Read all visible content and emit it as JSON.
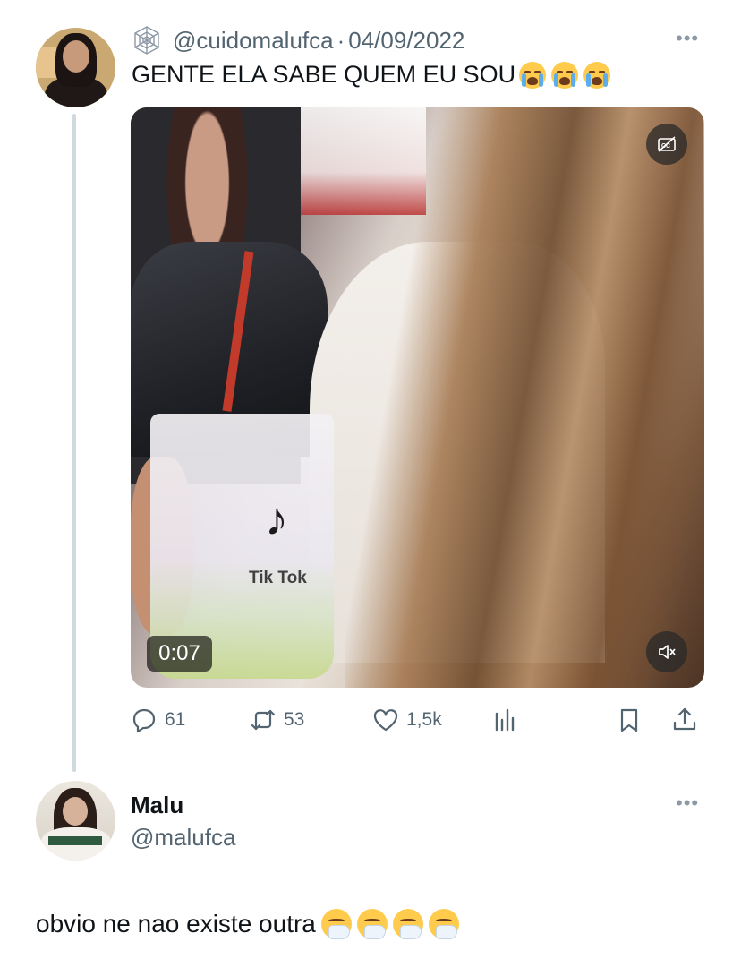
{
  "original_tweet": {
    "handle": "@cuidomalufca",
    "separator": "·",
    "date": "04/09/2022",
    "text": "GENTE ELA SABE QUEM EU SOU",
    "emojis": [
      "loudly-crying-face",
      "loudly-crying-face",
      "loudly-crying-face"
    ],
    "more_label": "•••",
    "media": {
      "duration": "0:07",
      "embedded_text": "Tik Tok",
      "captions_icon": "closed-captions-off-icon",
      "mute_icon": "speaker-muted-icon"
    },
    "actions": {
      "replies": "61",
      "retweets": "53",
      "likes": "1,5k",
      "views_icon": "analytics-icon",
      "bookmark_icon": "bookmark-icon",
      "share_icon": "share-icon"
    }
  },
  "reply": {
    "name": "Malu",
    "handle": "@malufca",
    "more_label": "•••",
    "text": "obvio ne nao existe outra",
    "emojis": [
      "sneezing-face",
      "sneezing-face",
      "sneezing-face",
      "sneezing-face"
    ]
  },
  "colors": {
    "text_primary": "#0f1419",
    "text_secondary": "#536471",
    "thread_line": "#cfd9de"
  }
}
